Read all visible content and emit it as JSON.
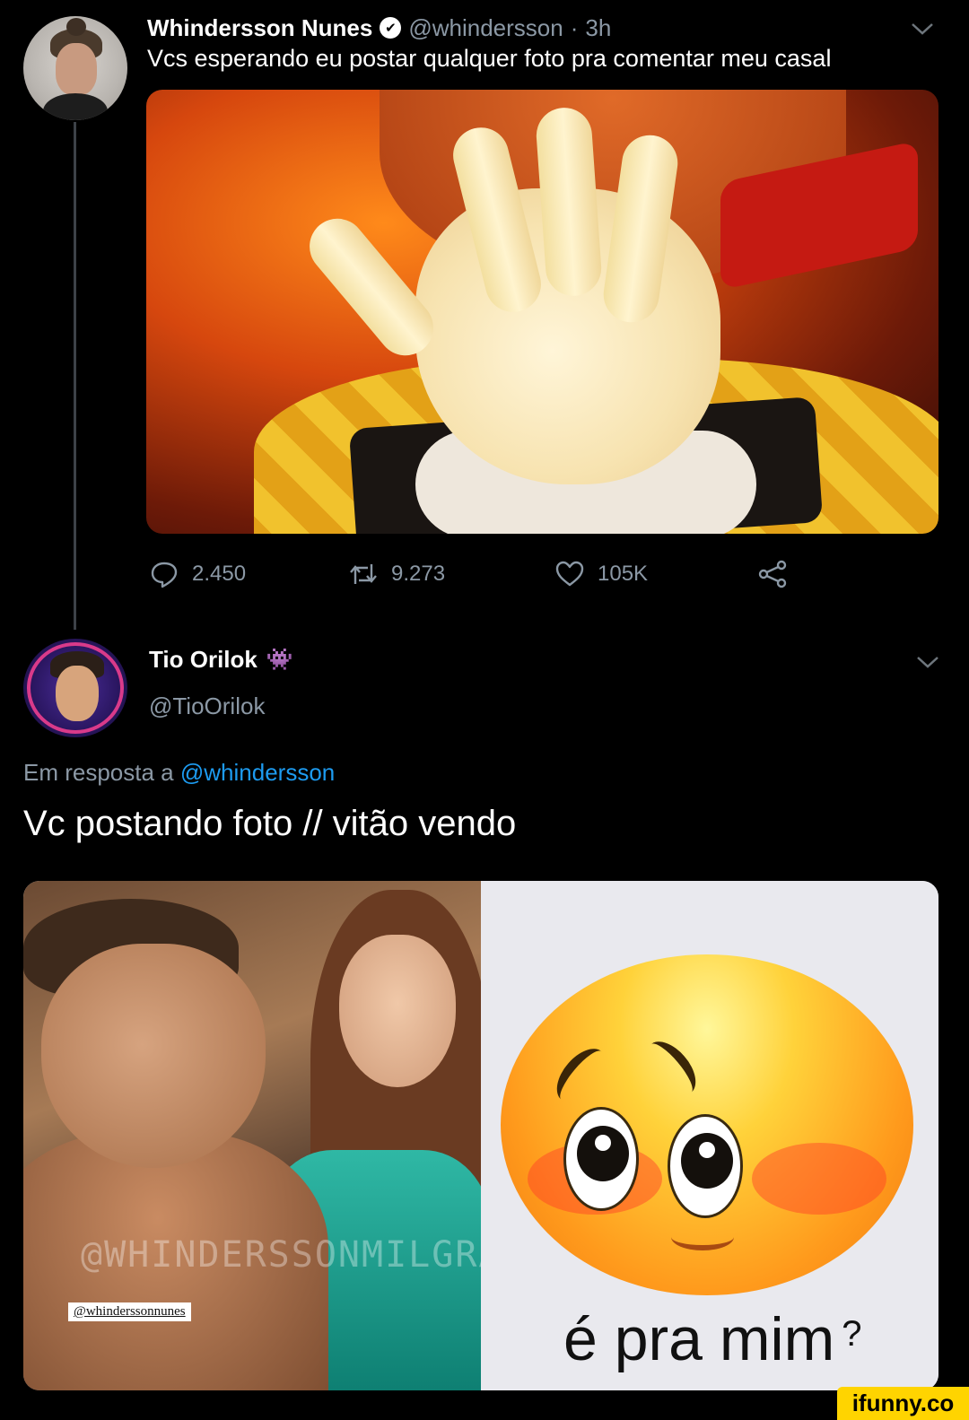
{
  "tweet1": {
    "author_name": "Whindersson Nunes",
    "verified_mark": "✔",
    "handle": "@whindersson",
    "separator": "·",
    "time": "3h",
    "text": "Vcs esperando eu postar qualquer foto pra comentar meu casal",
    "actions": {
      "replies": "2.450",
      "retweets": "9.273",
      "likes": "105K"
    },
    "icons": [
      "reply-icon",
      "retweet-icon",
      "like-icon",
      "share-icon",
      "chevron-down-icon"
    ]
  },
  "tweet2": {
    "author_name": "Tio Orilok",
    "emoji": "👾",
    "handle": "@TioOrilok",
    "reply_prefix": "Em resposta a",
    "reply_mention": "@whindersson",
    "text": "Vc postando foto // vitão vendo",
    "photo_watermark": "@WHINDERSSONMILGRAU",
    "photo_tag": "@whinderssonnunes",
    "emoji_caption": "é pra mim",
    "emoji_caption_mark": "?"
  },
  "watermark": {
    "label": "ifunny.co"
  },
  "colors": {
    "background": "#000000",
    "secondary_text": "#8b98a5",
    "link": "#1d9bf0",
    "ifunny_yellow": "#ffd400"
  }
}
